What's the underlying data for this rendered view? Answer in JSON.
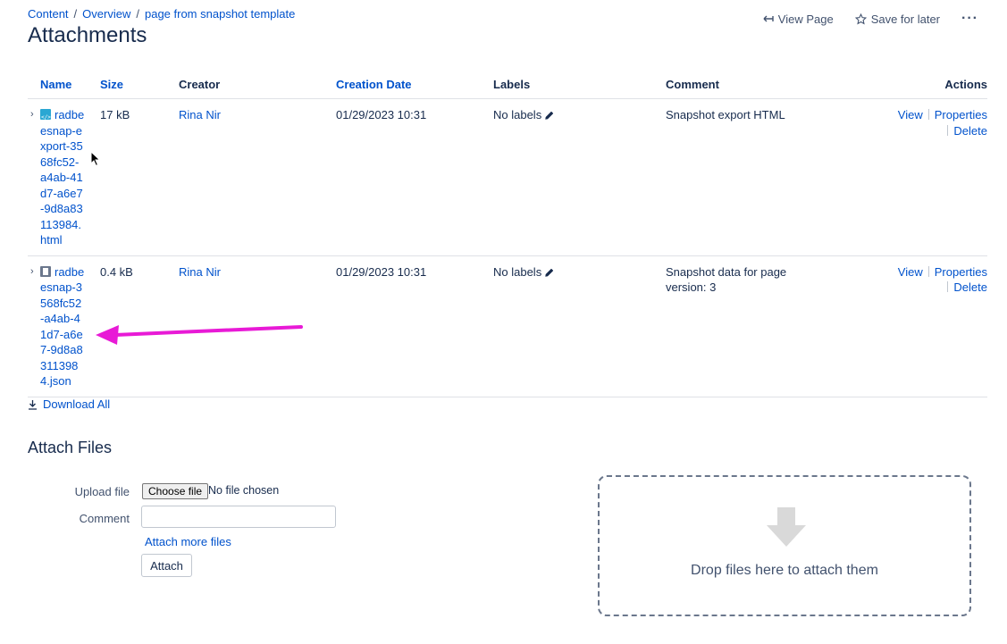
{
  "breadcrumb": {
    "items": [
      "Content",
      "Overview",
      "page from snapshot template"
    ],
    "separator": "/"
  },
  "page_title": "Attachments",
  "top_actions": {
    "view_page": "View Page",
    "save_for_later": "Save for later",
    "more": "···"
  },
  "table": {
    "headers": {
      "name": "Name",
      "size": "Size",
      "creator": "Creator",
      "creation_date": "Creation Date",
      "labels": "Labels",
      "comment": "Comment",
      "actions": "Actions"
    },
    "rows": [
      {
        "file_type_icon": "html-file-icon",
        "name": "radbeesnap-export-3568fc52-a4ab-41d7-a6e7-9d8a83113984.html",
        "size": "17 kB",
        "creator": "Rina Nir",
        "creation_date": "01/29/2023 10:31",
        "labels": "No labels",
        "comment": "Snapshot export HTML",
        "actions": {
          "view": "View",
          "properties": "Properties",
          "delete": "Delete"
        }
      },
      {
        "file_type_icon": "json-file-icon",
        "name": "radbeesnap-3568fc52-a4ab-41d7-a6e7-9d8a83113984.json",
        "size": "0.4 kB",
        "creator": "Rina Nir",
        "creation_date": "01/29/2023 10:31",
        "labels": "No labels",
        "comment": "Snapshot data for page version: 3",
        "actions": {
          "view": "View",
          "properties": "Properties",
          "delete": "Delete"
        }
      }
    ]
  },
  "download_all": "Download All",
  "attach": {
    "heading": "Attach Files",
    "upload_label": "Upload file",
    "choose_button": "Choose file",
    "no_file": "No file chosen",
    "comment_label": "Comment",
    "comment_value": "",
    "attach_more": "Attach more files",
    "attach_button": "Attach"
  },
  "dropzone": {
    "text": "Drop files here to attach them"
  },
  "colors": {
    "link": "#0052cc",
    "text": "#172b4d",
    "annotation_arrow": "#e81ad6",
    "dropzone_arrow": "#d9d9d9"
  }
}
